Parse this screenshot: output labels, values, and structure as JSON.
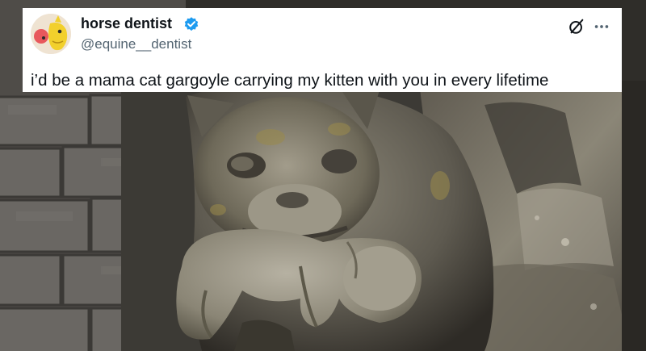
{
  "tweet": {
    "display_name": "horse dentist",
    "handle": "@equine__dentist",
    "text": "i’d be a mama cat gargoyle carrying my kitten with you in every lifetime",
    "verified": true,
    "icons": {
      "avatar": "horse-avatar",
      "verified": "verified-badge-icon",
      "grok": "grok-icon",
      "more": "more-options-icon"
    },
    "colors": {
      "name": "#0f1419",
      "handle": "#536471",
      "verified": "#1d9bf0",
      "card_background": "#ffffff"
    }
  },
  "photo": {
    "subject": "stone cat gargoyle carrying a kitten in its mouth"
  }
}
